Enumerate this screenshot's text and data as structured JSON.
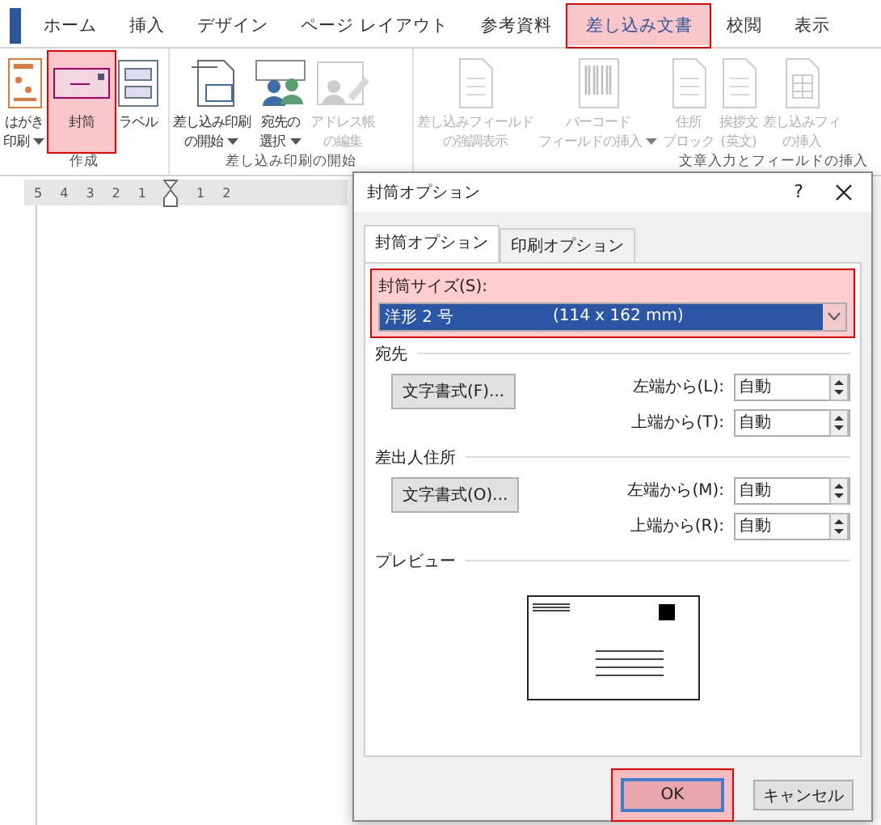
{
  "ribbon_tabs": [
    {
      "label": "ホーム",
      "selected": false,
      "highlighted": false
    },
    {
      "label": "挿入",
      "selected": false,
      "highlighted": false
    },
    {
      "label": "デザイン",
      "selected": false,
      "highlighted": false
    },
    {
      "label": "ページ レイアウト",
      "selected": false,
      "highlighted": false
    },
    {
      "label": "参考資料",
      "selected": false,
      "highlighted": false
    },
    {
      "label": "差し込み文書",
      "selected": true,
      "highlighted": true
    },
    {
      "label": "校閲",
      "selected": false,
      "highlighted": false
    },
    {
      "label": "表示",
      "selected": false,
      "highlighted": false
    }
  ],
  "ribbon_groups": [
    {
      "label": "作成",
      "buttons": [
        {
          "kind": "postcard",
          "lines": [
            "はがき",
            "印刷"
          ],
          "dropdown": true,
          "disabled": false,
          "highlighted": false
        },
        {
          "kind": "envelope",
          "lines": [
            "封筒"
          ],
          "dropdown": false,
          "disabled": false,
          "highlighted": true
        },
        {
          "kind": "label",
          "lines": [
            "ラベル"
          ],
          "dropdown": false,
          "disabled": false,
          "highlighted": false
        }
      ]
    },
    {
      "label": "差し込み印刷の開始",
      "buttons": [
        {
          "kind": "merge",
          "lines": [
            "差し込み印刷",
            "の開始"
          ],
          "dropdown": true,
          "disabled": false,
          "highlighted": false
        },
        {
          "kind": "recipients",
          "lines": [
            "宛先の",
            "選択"
          ],
          "dropdown": true,
          "disabled": false,
          "highlighted": false
        },
        {
          "kind": "addressbook",
          "lines": [
            "アドレス帳",
            "の編集"
          ],
          "dropdown": false,
          "disabled": true,
          "highlighted": false
        }
      ]
    },
    {
      "label": "文章入力とフィールドの挿入",
      "buttons": [
        {
          "kind": "document",
          "lines": [
            "差し込みフィールド",
            "の強調表示"
          ],
          "dropdown": false,
          "disabled": true,
          "highlighted": false
        },
        {
          "kind": "barcode",
          "lines": [
            "バーコード",
            "フィールドの挿入"
          ],
          "dropdown": true,
          "disabled": true,
          "highlighted": false
        },
        {
          "kind": "document",
          "lines": [
            "住所",
            "ブロック"
          ],
          "dropdown": false,
          "disabled": true,
          "highlighted": false
        },
        {
          "kind": "document",
          "lines": [
            "挨拶文",
            "(英文)"
          ],
          "dropdown": false,
          "disabled": true,
          "highlighted": false
        },
        {
          "kind": "table",
          "lines": [
            "差し込みフィ",
            "の挿入"
          ],
          "dropdown": false,
          "disabled": true,
          "highlighted": false
        }
      ]
    }
  ],
  "ruler": {
    "left_numbers": [
      "5",
      "4",
      "3",
      "2",
      "1"
    ],
    "right_numbers": [
      "1",
      "2"
    ]
  },
  "dialog": {
    "title": "封筒オプション",
    "help": "?",
    "tabs": [
      {
        "label": "封筒オプション",
        "selected": true
      },
      {
        "label": "印刷オプション",
        "selected": false
      }
    ],
    "envelope_size": {
      "label": "封筒サイズ(S):",
      "name": "洋形 2 号",
      "dimensions": "(114 x 162 mm)",
      "highlighted": true
    },
    "sections": [
      {
        "title": "宛先",
        "font_button": "文字書式(F)...",
        "fields": [
          {
            "label": "左端から(L):",
            "value": "自動"
          },
          {
            "label": "上端から(T):",
            "value": "自動"
          }
        ]
      },
      {
        "title": "差出人住所",
        "font_button": "文字書式(O)...",
        "fields": [
          {
            "label": "左端から(M):",
            "value": "自動"
          },
          {
            "label": "上端から(R):",
            "value": "自動"
          }
        ]
      }
    ],
    "preview_label": "プレビュー",
    "buttons": [
      {
        "label": "OK",
        "default": true,
        "highlighted": true
      },
      {
        "label": "キャンセル",
        "default": false,
        "highlighted": false
      }
    ]
  }
}
